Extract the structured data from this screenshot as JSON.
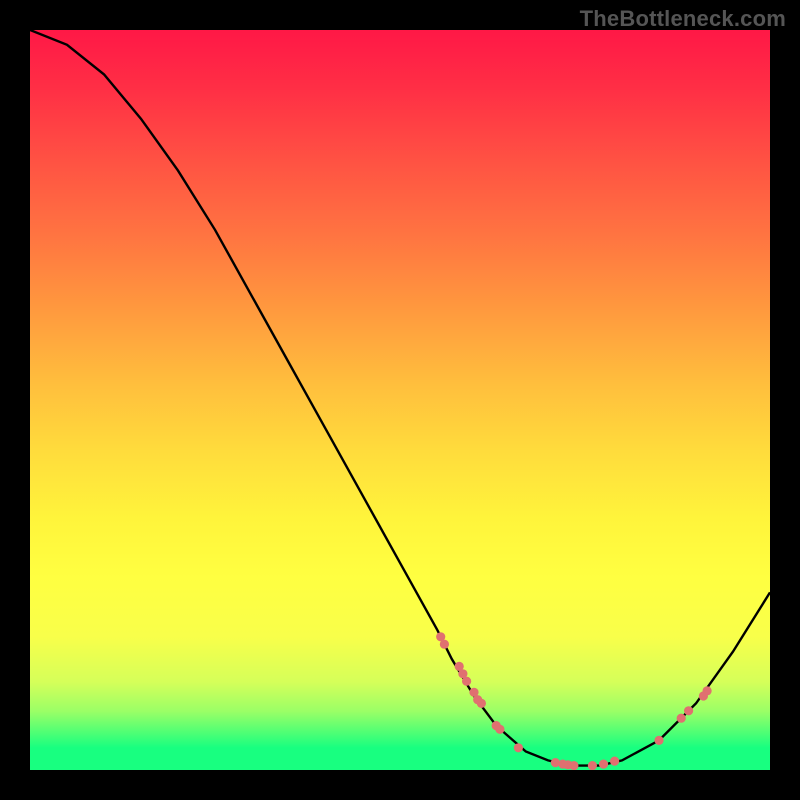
{
  "watermark": "TheBottleneck.com",
  "chart_data": {
    "type": "line",
    "title": "",
    "xlabel": "",
    "ylabel": "",
    "xlim": [
      0,
      100
    ],
    "ylim": [
      0,
      100
    ],
    "series": [
      {
        "name": "curve",
        "x": [
          0,
          5,
          10,
          15,
          20,
          25,
          30,
          35,
          40,
          45,
          50,
          55,
          57,
          60,
          63,
          67,
          70,
          73,
          77,
          80,
          85,
          90,
          95,
          100
        ],
        "y": [
          100,
          98,
          94,
          88,
          81,
          73,
          64,
          55,
          46,
          37,
          28,
          19,
          15,
          10,
          6,
          2.5,
          1.3,
          0.6,
          0.6,
          1.3,
          4,
          9,
          16,
          24
        ]
      }
    ],
    "markers": [
      {
        "x": 55.5,
        "y": 18
      },
      {
        "x": 56,
        "y": 17
      },
      {
        "x": 58,
        "y": 14
      },
      {
        "x": 58.5,
        "y": 13
      },
      {
        "x": 59,
        "y": 12
      },
      {
        "x": 60,
        "y": 10.5
      },
      {
        "x": 60.5,
        "y": 9.5
      },
      {
        "x": 61,
        "y": 9
      },
      {
        "x": 63,
        "y": 6
      },
      {
        "x": 63.5,
        "y": 5.5
      },
      {
        "x": 66,
        "y": 3
      },
      {
        "x": 71,
        "y": 1
      },
      {
        "x": 72,
        "y": 0.8
      },
      {
        "x": 72.7,
        "y": 0.7
      },
      {
        "x": 73.5,
        "y": 0.6
      },
      {
        "x": 76,
        "y": 0.6
      },
      {
        "x": 77.5,
        "y": 0.8
      },
      {
        "x": 79,
        "y": 1.2
      },
      {
        "x": 85,
        "y": 4
      },
      {
        "x": 88,
        "y": 7
      },
      {
        "x": 89,
        "y": 8
      },
      {
        "x": 91,
        "y": 10
      },
      {
        "x": 91.5,
        "y": 10.7
      }
    ],
    "marker_color": "#e07070",
    "curve_color": "#000000"
  }
}
